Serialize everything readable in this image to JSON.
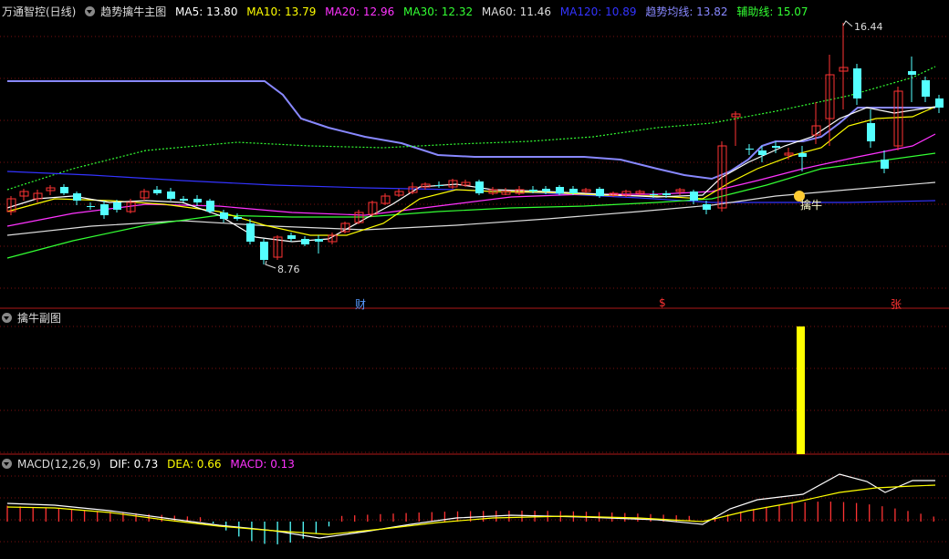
{
  "main_panel": {
    "stock_title": "万通智控(日线)",
    "indicator_name": "趋势擒牛主图",
    "ma_labels": [
      {
        "text": "MA5: 13.80",
        "color": "#ffffff"
      },
      {
        "text": "MA10: 13.79",
        "color": "#ffff00"
      },
      {
        "text": "MA20: 12.96",
        "color": "#ff33ff"
      },
      {
        "text": "MA30: 12.32",
        "color": "#33ff33"
      },
      {
        "text": "MA60: 11.46",
        "color": "#dddddd"
      },
      {
        "text": "MA120: 10.89",
        "color": "#3333ff"
      },
      {
        "text": "趋势均线: 13.82",
        "color": "#8888ff"
      },
      {
        "text": "辅助线: 15.07",
        "color": "#33ff33"
      }
    ],
    "high_label": "16.44",
    "low_label": "8.76",
    "signal_label": "擒牛",
    "bottom_markers": [
      {
        "text": "财",
        "color": "#5599ff"
      },
      {
        "text": "$",
        "color": "#ff3333"
      },
      {
        "text": "张",
        "color": "#ff3333"
      }
    ]
  },
  "sub_panel": {
    "title": "擒牛副图"
  },
  "macd_panel": {
    "title": "MACD(12,26,9)",
    "dif_label": "DIF: 0.73",
    "dea_label": "DEA: 0.66",
    "macd_label": "MACD: 0.13"
  },
  "colors": {
    "grid": "#7a1010",
    "up": "#ff3333",
    "down": "#54ffff",
    "ma5": "#ffffff",
    "ma10": "#ffff00",
    "ma20": "#ff33ff",
    "ma30": "#33ff33",
    "ma60": "#dddddd",
    "ma120": "#3333ff",
    "trend": "#8888ff",
    "aux": "#33ff33",
    "signal_bar": "#ffff00"
  }
}
